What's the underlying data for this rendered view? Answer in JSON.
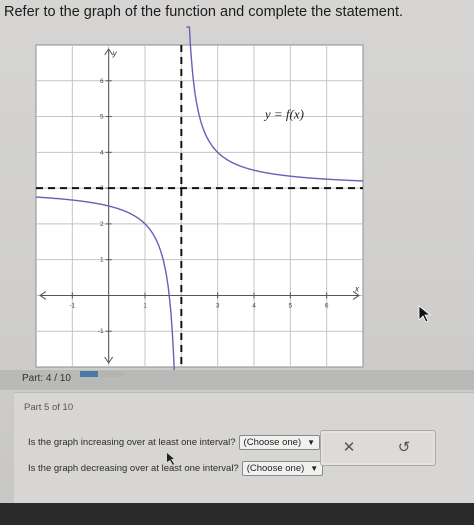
{
  "problem": {
    "statement": "Refer to the graph of the function and complete the statement."
  },
  "graph": {
    "y_axis_label": "y",
    "x_axis_label": "x",
    "curve_label": "y = f(x)",
    "x_range": [
      -2,
      7
    ],
    "y_range": [
      -2,
      7
    ],
    "x_tick_labels": [
      "-1",
      "1",
      "3",
      "4",
      "5",
      "6"
    ],
    "y_tick_labels": [
      "6",
      "5",
      "4",
      "3",
      "2",
      "1",
      "-1"
    ],
    "vertical_asymptote": 2,
    "horizontal_asymptote": 3,
    "grid": true,
    "colors": {
      "curve": "#6a5fb5",
      "asymptote": "#111111",
      "grid": "#c4c4c4",
      "axis": "#555555"
    }
  },
  "progress": {
    "label": "Part: 4 / 10",
    "completed_fraction": 0.4
  },
  "part": {
    "title": "Part 5 of 10",
    "questions": [
      {
        "text": "Is the graph increasing over at least one interval?",
        "dropdown_value": "(Choose one)"
      },
      {
        "text": "Is the graph decreasing over at least one interval?",
        "dropdown_value": "(Choose one)"
      }
    ]
  },
  "icons": [
    "close-icon",
    "undo-icon",
    "dropdown-arrow-icon",
    "mouse-pointer-icon"
  ]
}
